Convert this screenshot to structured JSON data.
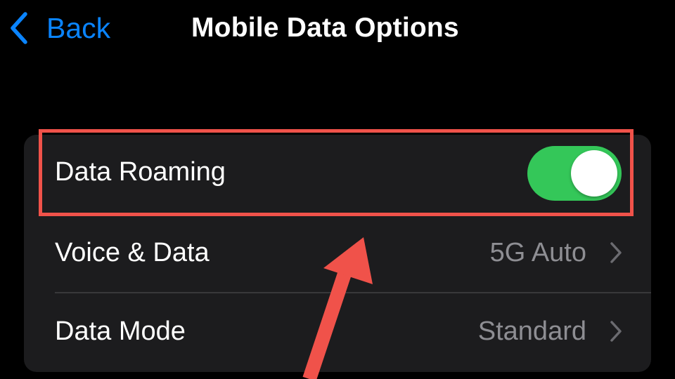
{
  "nav": {
    "back_label": "Back",
    "title": "Mobile Data Options"
  },
  "icons": {
    "back": "chevron-left-icon",
    "disclosure": "chevron-right-icon"
  },
  "colors": {
    "accent": "#0a84ff",
    "toggle_on": "#34c759",
    "annotation": "#f0524a",
    "group_background": "#1c1c1e",
    "secondary_text": "#8e8e93"
  },
  "settings": {
    "data_roaming": {
      "label": "Data Roaming",
      "enabled": true
    },
    "voice_data": {
      "label": "Voice & Data",
      "value": "5G Auto"
    },
    "data_mode": {
      "label": "Data Mode",
      "value": "Standard"
    }
  }
}
